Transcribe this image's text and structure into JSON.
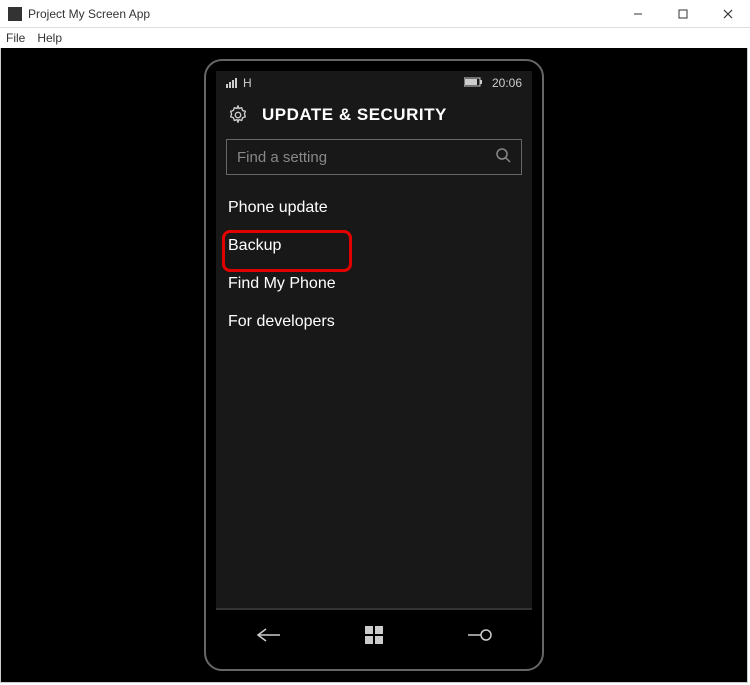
{
  "window": {
    "title": "Project My Screen App",
    "menu": {
      "file": "File",
      "help": "Help"
    }
  },
  "phone": {
    "status": {
      "network_label": "H",
      "time": "20:06"
    },
    "header": {
      "title": "UPDATE & SECURITY"
    },
    "search": {
      "placeholder": "Find a setting"
    },
    "menu_items": [
      "Phone update",
      "Backup",
      "Find My Phone",
      "For developers"
    ],
    "highlighted_index": 1
  }
}
